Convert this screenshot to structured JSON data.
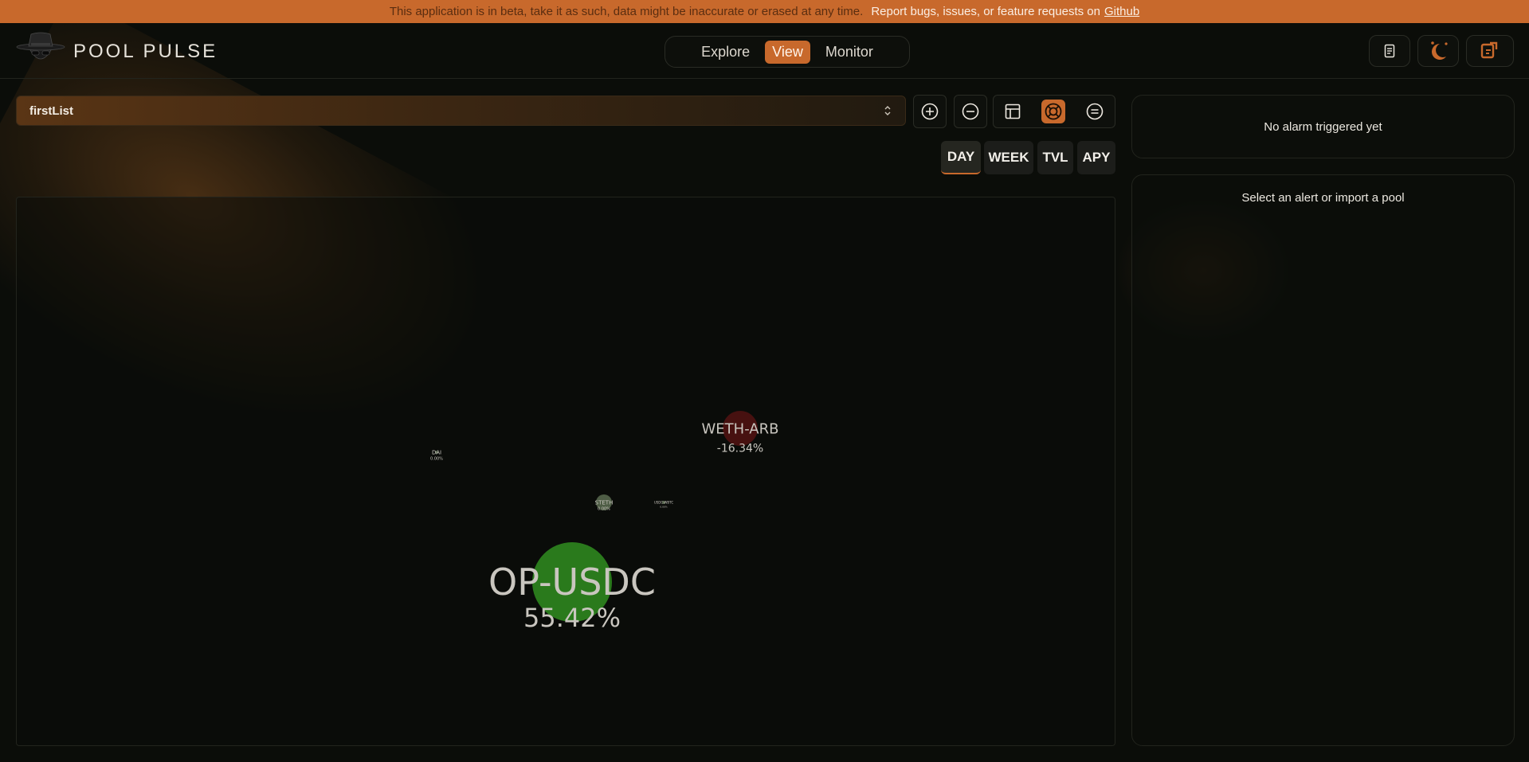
{
  "banner": {
    "notice": "This application is in beta, take it as such, data might be inaccurate or erased at any time.",
    "report_text": "Report bugs, issues, or feature requests on",
    "link_text": "Github"
  },
  "header": {
    "app_title": "POOL PULSE",
    "nav": [
      {
        "label": "Explore",
        "active": false
      },
      {
        "label": "View",
        "active": true
      },
      {
        "label": "Monitor",
        "active": false
      }
    ],
    "icons": [
      "document-icon",
      "moon-icon",
      "swap-icon"
    ]
  },
  "list_selector": {
    "value": "firstList"
  },
  "timeframes": [
    {
      "label": "DAY",
      "active": true
    },
    {
      "label": "WEEK",
      "active": false
    },
    {
      "label": "TVL",
      "active": false
    },
    {
      "label": "APY",
      "active": false
    }
  ],
  "alerts_panel": {
    "empty_text": "No alarm triggered yet"
  },
  "detail_panel": {
    "empty_text": "Select an alert or import a pool"
  },
  "colors": {
    "accent": "#c8692c",
    "positive": "#2a7a1c",
    "negative": "#7a1616",
    "neutral": "#6b8060"
  },
  "chart_data": {
    "type": "bubble",
    "value_label": "day change",
    "bubbles": [
      {
        "name": "OP-USDC",
        "value": "55.42%",
        "change": 55.42
      },
      {
        "name": "WETH-ARB",
        "value": "-16.34%",
        "change": -16.34
      },
      {
        "name": "DAI",
        "value": "0.00%",
        "change": 0.0
      },
      {
        "name": "STETH",
        "value": "0.00%",
        "change": 0.0
      },
      {
        "name": "USDC-WBTC",
        "value": "0.00%",
        "change": 0.0
      }
    ]
  }
}
